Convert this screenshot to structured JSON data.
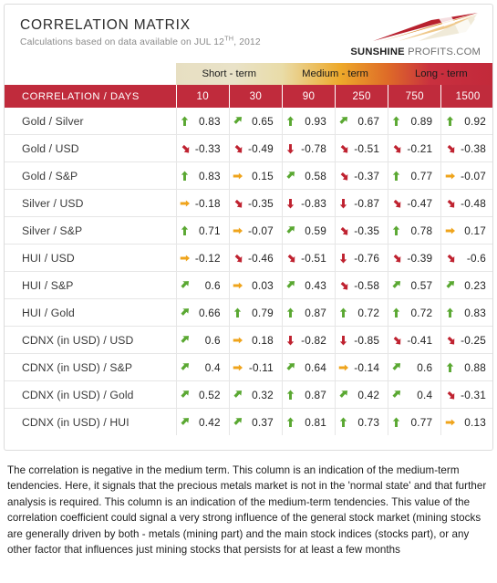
{
  "header": {
    "title": "CORRELATION MATRIX",
    "subtitle_prefix": "Calculations based on data available on ",
    "date_main": "JUL 12",
    "date_ordinal": "TH",
    "date_suffix": ", 2012",
    "logo_bold": "SUNSHINE",
    "logo_light": " PROFITS.COM"
  },
  "colors": {
    "brand_red": "#c02b3c",
    "gradient_cream": "#e7dfc2",
    "gradient_orange": "#eda92a",
    "gradient_red": "#c2293a",
    "arrow_up": "#5aa832",
    "arrow_down": "#bf2230",
    "arrow_flat": "#efa41c"
  },
  "table": {
    "terms": [
      {
        "label": "Short - term",
        "span": 2
      },
      {
        "label": "Medium - term",
        "span": 2
      },
      {
        "label": "Long - term",
        "span": 2
      }
    ],
    "corner_label": "CORRELATION / DAYS",
    "days": [
      "10",
      "30",
      "90",
      "250",
      "750",
      "1500"
    ],
    "rows": [
      {
        "label": "Gold / Silver",
        "cells": [
          {
            "value": "0.83",
            "arrow": "up"
          },
          {
            "value": "0.65",
            "arrow": "up-right"
          },
          {
            "value": "0.93",
            "arrow": "up"
          },
          {
            "value": "0.67",
            "arrow": "up-right"
          },
          {
            "value": "0.89",
            "arrow": "up"
          },
          {
            "value": "0.92",
            "arrow": "up"
          }
        ]
      },
      {
        "label": "Gold / USD",
        "cells": [
          {
            "value": "-0.33",
            "arrow": "down-right"
          },
          {
            "value": "-0.49",
            "arrow": "down-right"
          },
          {
            "value": "-0.78",
            "arrow": "down"
          },
          {
            "value": "-0.51",
            "arrow": "down-right"
          },
          {
            "value": "-0.21",
            "arrow": "down-right"
          },
          {
            "value": "-0.38",
            "arrow": "down-right"
          }
        ]
      },
      {
        "label": "Gold / S&P",
        "cells": [
          {
            "value": "0.83",
            "arrow": "up"
          },
          {
            "value": "0.15",
            "arrow": "flat"
          },
          {
            "value": "0.58",
            "arrow": "up-right"
          },
          {
            "value": "-0.37",
            "arrow": "down-right"
          },
          {
            "value": "0.77",
            "arrow": "up"
          },
          {
            "value": "-0.07",
            "arrow": "flat"
          }
        ]
      },
      {
        "label": "Silver / USD",
        "cells": [
          {
            "value": "-0.18",
            "arrow": "flat"
          },
          {
            "value": "-0.35",
            "arrow": "down-right"
          },
          {
            "value": "-0.83",
            "arrow": "down"
          },
          {
            "value": "-0.87",
            "arrow": "down"
          },
          {
            "value": "-0.47",
            "arrow": "down-right"
          },
          {
            "value": "-0.48",
            "arrow": "down-right"
          }
        ]
      },
      {
        "label": "Silver / S&P",
        "cells": [
          {
            "value": "0.71",
            "arrow": "up"
          },
          {
            "value": "-0.07",
            "arrow": "flat"
          },
          {
            "value": "0.59",
            "arrow": "up-right"
          },
          {
            "value": "-0.35",
            "arrow": "down-right"
          },
          {
            "value": "0.78",
            "arrow": "up"
          },
          {
            "value": "0.17",
            "arrow": "flat"
          }
        ]
      },
      {
        "label": "HUI / USD",
        "cells": [
          {
            "value": "-0.12",
            "arrow": "flat"
          },
          {
            "value": "-0.46",
            "arrow": "down-right"
          },
          {
            "value": "-0.51",
            "arrow": "down-right"
          },
          {
            "value": "-0.76",
            "arrow": "down"
          },
          {
            "value": "-0.39",
            "arrow": "down-right"
          },
          {
            "value": "-0.6",
            "arrow": "down-right"
          }
        ]
      },
      {
        "label": "HUI / S&P",
        "cells": [
          {
            "value": "0.6",
            "arrow": "up-right"
          },
          {
            "value": "0.03",
            "arrow": "flat"
          },
          {
            "value": "0.43",
            "arrow": "up-right"
          },
          {
            "value": "-0.58",
            "arrow": "down-right"
          },
          {
            "value": "0.57",
            "arrow": "up-right"
          },
          {
            "value": "0.23",
            "arrow": "up-right"
          }
        ]
      },
      {
        "label": "HUI / Gold",
        "cells": [
          {
            "value": "0.66",
            "arrow": "up-right"
          },
          {
            "value": "0.79",
            "arrow": "up"
          },
          {
            "value": "0.87",
            "arrow": "up"
          },
          {
            "value": "0.72",
            "arrow": "up"
          },
          {
            "value": "0.72",
            "arrow": "up"
          },
          {
            "value": "0.83",
            "arrow": "up"
          }
        ]
      },
      {
        "label": "CDNX (in USD) / USD",
        "cells": [
          {
            "value": "0.6",
            "arrow": "up-right"
          },
          {
            "value": "0.18",
            "arrow": "flat"
          },
          {
            "value": "-0.82",
            "arrow": "down"
          },
          {
            "value": "-0.85",
            "arrow": "down"
          },
          {
            "value": "-0.41",
            "arrow": "down-right"
          },
          {
            "value": "-0.25",
            "arrow": "down-right"
          }
        ]
      },
      {
        "label": "CDNX (in USD) / S&P",
        "cells": [
          {
            "value": "0.4",
            "arrow": "up-right"
          },
          {
            "value": "-0.11",
            "arrow": "flat"
          },
          {
            "value": "0.64",
            "arrow": "up-right"
          },
          {
            "value": "-0.14",
            "arrow": "flat"
          },
          {
            "value": "0.6",
            "arrow": "up-right"
          },
          {
            "value": "0.88",
            "arrow": "up"
          }
        ]
      },
      {
        "label": "CDNX (in USD) / Gold",
        "cells": [
          {
            "value": "0.52",
            "arrow": "up-right"
          },
          {
            "value": "0.32",
            "arrow": "up-right"
          },
          {
            "value": "0.87",
            "arrow": "up"
          },
          {
            "value": "0.42",
            "arrow": "up-right"
          },
          {
            "value": "0.4",
            "arrow": "up-right"
          },
          {
            "value": "-0.31",
            "arrow": "down-right"
          }
        ]
      },
      {
        "label": "CDNX (in USD) / HUI",
        "cells": [
          {
            "value": "0.42",
            "arrow": "up-right"
          },
          {
            "value": "0.37",
            "arrow": "up-right"
          },
          {
            "value": "0.81",
            "arrow": "up"
          },
          {
            "value": "0.73",
            "arrow": "up"
          },
          {
            "value": "0.77",
            "arrow": "up"
          },
          {
            "value": "0.13",
            "arrow": "flat"
          }
        ]
      }
    ]
  },
  "note": "The correlation is negative in the medium term. This column is an indication of the medium-term tendencies. Here, it signals that the precious metals market is not in the 'normal state' and that further analysis is required. This column is an indication of the medium-term tendencies. This value of the correlation coefficient could signal a very strong influence of the general stock market (mining stocks are generally driven by both - metals (mining part) and the main stock indices (stocks part), or any other factor that influences just mining stocks that persists for at least a few months"
}
